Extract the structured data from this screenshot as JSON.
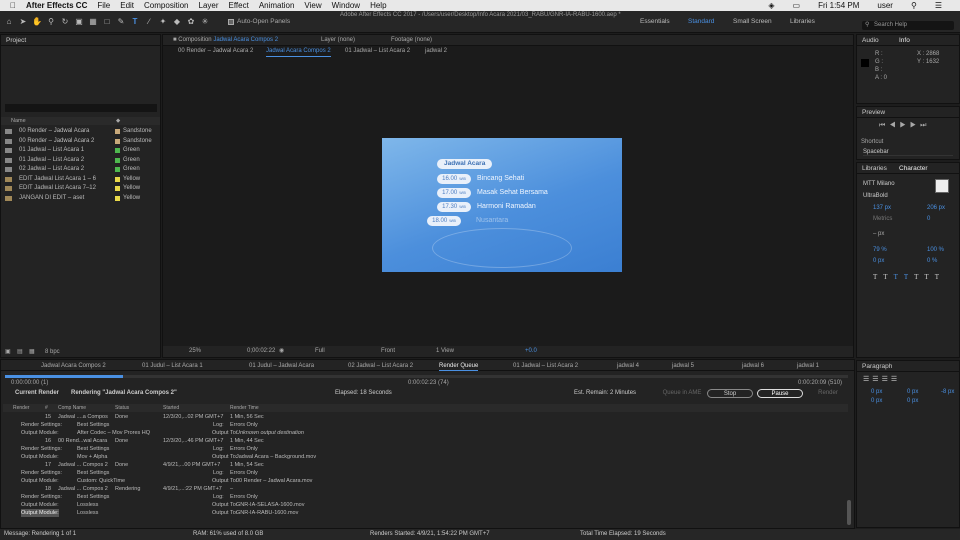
{
  "menubar": {
    "apple": "",
    "app": "After Effects CC",
    "items": [
      "File",
      "Edit",
      "Composition",
      "Layer",
      "Effect",
      "Animation",
      "View",
      "Window",
      "Help"
    ],
    "clock": "Fri 1:54 PM",
    "user": "user"
  },
  "window": {
    "title": "Adobe After Effects CC 2017 - /Users/user/Desktop/Info Acara 2021/03_RABU/GNR-IA-RABU-1600.aep *"
  },
  "toolbar": {
    "auto_open": "Auto-Open Panels"
  },
  "workspaces": [
    "Essentials",
    "Standard",
    "Small Screen",
    "Libraries"
  ],
  "search": {
    "placeholder": "Search Help"
  },
  "project": {
    "title": "Project",
    "col_name": "Name",
    "bpc": "8 bpc",
    "items": [
      {
        "name": "00 Render – Jadwal Acara",
        "label": "Sandstone",
        "color": "#c8a97a",
        "type": "comp"
      },
      {
        "name": "00 Render – Jadwal Acara 2",
        "label": "Sandstone",
        "color": "#c8a97a",
        "type": "comp"
      },
      {
        "name": "01 Jadwal – List Acara 1",
        "label": "Green",
        "color": "#4fb84f",
        "type": "comp"
      },
      {
        "name": "01 Jadwal – List Acara 2",
        "label": "Green",
        "color": "#4fb84f",
        "type": "comp"
      },
      {
        "name": "02 Jadwal – List Acara 2",
        "label": "Green",
        "color": "#4fb84f",
        "type": "comp"
      },
      {
        "name": "EDIT Jadwal List Acara 1 – 6",
        "label": "Yellow",
        "color": "#e8d84a",
        "type": "folder"
      },
      {
        "name": "EDIT Jadwal List Acara 7–12",
        "label": "Yellow",
        "color": "#e8d84a",
        "type": "folder"
      },
      {
        "name": "JANGAN DI EDIT – aset",
        "label": "Yellow",
        "color": "#e8d84a",
        "type": "folder"
      }
    ]
  },
  "viewer": {
    "comp_tab_prefix": "Composition",
    "comp_tab_name": "Jadwal Acara Compos 2",
    "layer_tab": "Layer (none)",
    "footage_tab": "Footage (none)",
    "breadcrumbs": [
      "00 Render – Jadwal Acara 2",
      "Jadwal Acara Compos 2",
      "01 Jadwal – List Acara 2",
      "jadwal 2"
    ],
    "zoom": "25%",
    "timecode": "0;00:02:22",
    "resolution": "Full",
    "view": "Front",
    "views": "1 View",
    "exposure": "+0.0"
  },
  "graphic": {
    "title": "Jadwal Acara",
    "rows": [
      {
        "time": "16.00",
        "unit": "WIB",
        "show": "Bincang Sehati"
      },
      {
        "time": "17.00",
        "unit": "WIB",
        "show": "Masak Sehat Bersama"
      },
      {
        "time": "17.30",
        "unit": "WIB",
        "show": "Harmoni Ramadan"
      },
      {
        "time": "18.00",
        "unit": "WIB",
        "show": "Nusantara"
      }
    ]
  },
  "info": {
    "tab_audio": "Audio",
    "tab_info": "Info",
    "r": "R :",
    "g": "G :",
    "b": "B :",
    "a": "A : 0",
    "x": "X : 2868",
    "y": "Y : 1632"
  },
  "preview": {
    "title": "Preview",
    "shortcut_label": "Shortcut",
    "shortcut": "Spacebar"
  },
  "character": {
    "tab_libraries": "Libraries",
    "tab_character": "Character",
    "font": "MTT Milano",
    "style": "UltraBold",
    "size": "137 px",
    "leading": "206 px",
    "kerning": "Metrics",
    "tracking": "0",
    "stroke": "– px",
    "vscale": "79 %",
    "hscale": "100 %",
    "baseline": "0 px",
    "tsume": "0 %"
  },
  "paragraph": {
    "title": "Paragraph",
    "indent_l": "0 px",
    "indent_r": "0 px",
    "first": "-8 px",
    "space_before": "0 px",
    "space_after": "0 px"
  },
  "timeline_tabs": [
    "Jadwal Acara Compos 2",
    "01 Judul – List Acara 1",
    "01 Judul – Jadwal Acara",
    "02 Jadwal – List Acara 2",
    "Render Queue",
    "01 Jadwal – List Acara 2",
    "jadwal 4",
    "jadwal 5",
    "jadwal 6",
    "jadwal 1"
  ],
  "render": {
    "start": "0:00:00:00 (1)",
    "mid": "0:00:02:23 (74)",
    "end": "0:00:20:09 (510)",
    "current_label": "Current Render",
    "rendering": "Rendering \"Jadwal Acara Compos 2\"",
    "elapsed": "Elapsed: 18 Seconds",
    "remain": "Est. Remain: 2 Minutes",
    "queue_ame": "Queue in AME",
    "stop": "Stop",
    "pause": "Pause",
    "render_btn": "Render",
    "progress": 0.14,
    "cols": [
      "Render",
      "#",
      "Comp Name",
      "Status",
      "Started",
      "Render Time"
    ],
    "items": [
      {
        "num": "15",
        "name": "Jadwal ....a Compos",
        "status": "Done",
        "started": "12/3/20,...02 PM GMT+7",
        "time": "1 Min, 56 Sec",
        "rs": "Best Settings",
        "log": "Errors Only",
        "om": "After Codec – Mov Prores HQ",
        "out": "Unknown output destination"
      },
      {
        "num": "16",
        "name": "00 Rend...wal Acara",
        "status": "Done",
        "started": "12/3/20,...46 PM GMT+7",
        "time": "1 Min, 44 Sec",
        "rs": "Best Settings",
        "log": "Errors Only",
        "om": "Mov + Alpha",
        "out": "Jadwal Acara – Background.mov"
      },
      {
        "num": "17",
        "name": "Jadwal ... Compos 2",
        "status": "Done",
        "started": "4/9/21,...00 PM GMT+7",
        "time": "1 Min, 54 Sec",
        "rs": "Best Settings",
        "log": "Errors Only",
        "om": "Custom: QuickTime",
        "out": "00 Render – Jadwal Acara.mov"
      },
      {
        "num": "18",
        "name": "Jadwal ... Compos 2",
        "status": "Rendering",
        "started": "4/9/21,...:22 PM GMT+7",
        "time": "–",
        "rs": "Best Settings",
        "log": "Errors Only",
        "om": "Lossless",
        "out": "GNR-IA-SELASA-1600.mov"
      }
    ],
    "extra_om": "Lossless",
    "extra_out": "GNR-IA-RABU-1600.mov",
    "rs_label": "Render Settings:",
    "om_label": "Output Module:",
    "log_label": "Log:",
    "out_label": "Output To:"
  },
  "status": {
    "message": "Message: Rendering 1 of 1",
    "ram": "RAM: 61% used of 8.0 GB",
    "started": "Renders Started: 4/9/21, 1:54:22 PM GMT+7",
    "total": "Total Time Elapsed: 19 Seconds"
  }
}
